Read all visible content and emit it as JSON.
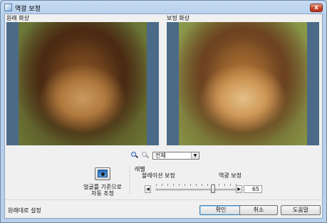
{
  "window": {
    "title": "역광 보정",
    "close_label": "x"
  },
  "original": {
    "label": "원래 화상"
  },
  "corrected": {
    "label": "보정 화상"
  },
  "zoom": {
    "select_value": "전체"
  },
  "auto": {
    "label_line1": "얼굴를 기준으로",
    "label_line2": "자동 조정"
  },
  "level": {
    "title": "레벨",
    "left_label": "할레이션 보정",
    "right_label": "역광 보정",
    "value": "65",
    "slider_fraction": 0.7
  },
  "footer": {
    "reset_label": "원래대로 설정",
    "ok_label": "확인",
    "cancel_label": "취소",
    "help_label": "도움말"
  },
  "icons": [
    "app-icon",
    "close-icon",
    "zoom-in-icon",
    "zoom-out-icon",
    "chevron-down-icon",
    "face-auto-icon",
    "arrow-left-icon",
    "arrow-right-icon"
  ]
}
